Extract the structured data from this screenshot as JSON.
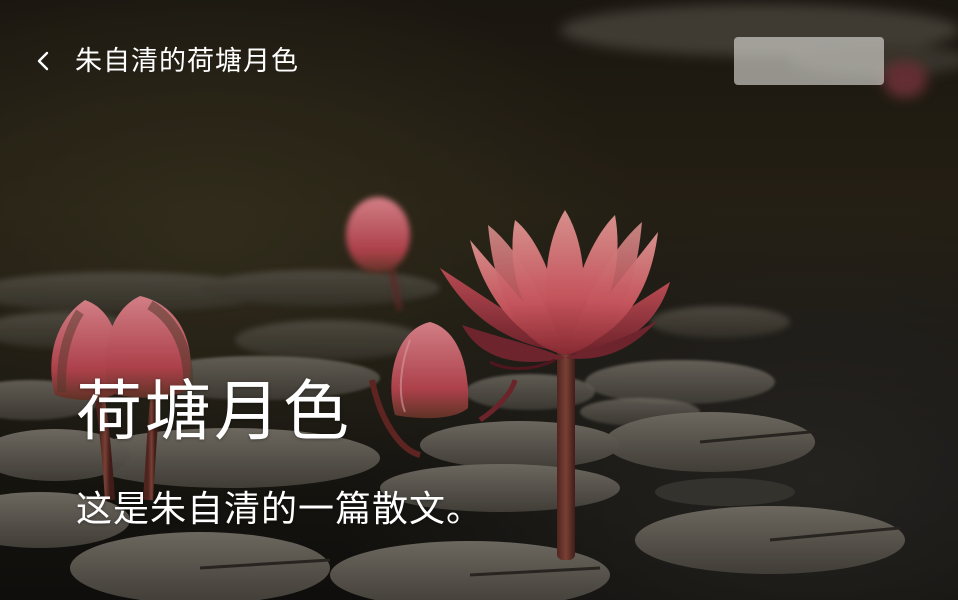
{
  "header": {
    "back_icon": "chevron-left-icon",
    "title": "朱自清的荷塘月色",
    "action_button_label": ""
  },
  "hero": {
    "title": "荷塘月色",
    "subtitle": "这是朱自清的一篇散文。"
  },
  "colors": {
    "text": "#ffffff",
    "lotus_pink": "#e96a72",
    "lotus_dark": "#8a2a33",
    "water_dark": "#15130f",
    "pad_gray": "#6f6a62"
  }
}
